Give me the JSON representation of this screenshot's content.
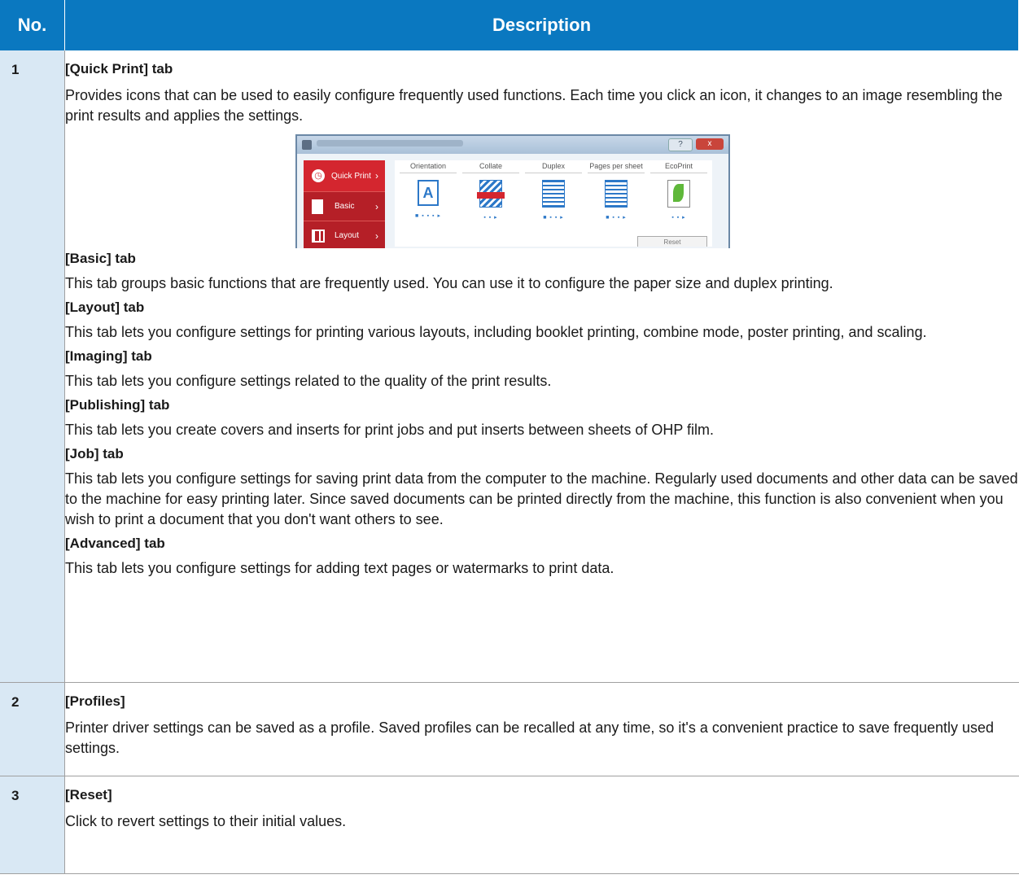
{
  "table": {
    "headers": {
      "no": "No.",
      "description": "Description"
    },
    "row1": {
      "no": "1",
      "sections": [
        {
          "heading": "[Quick Print] tab",
          "text": "Provides icons that can be used to easily configure frequently used functions. Each time you click an icon, it changes to an image resembling the print results and applies the settings."
        },
        {
          "heading": "[Basic] tab",
          "text": "This tab groups basic functions that are frequently used. You can use it to configure the paper size and duplex printing."
        },
        {
          "heading": "[Layout] tab",
          "text": "This tab lets you configure settings for printing various layouts, including booklet printing, combine mode, poster printing, and scaling."
        },
        {
          "heading": "[Imaging] tab",
          "text": "This tab lets you configure settings related to the quality of the print results."
        },
        {
          "heading": "[Publishing] tab",
          "text": "This tab lets you create covers and inserts for print jobs and put inserts between sheets of OHP film."
        },
        {
          "heading": "[Job] tab",
          "text": "This tab lets you configure settings for saving print data from the computer to the machine. Regularly used documents and other data can be saved to the machine for easy printing later. Since saved documents can be printed directly from the machine, this function is also convenient when you wish to print a document that you don't want others to see."
        },
        {
          "heading": "[Advanced] tab",
          "text": "This tab lets you configure settings for adding text pages or watermarks to print data."
        }
      ]
    },
    "row2": {
      "no": "2",
      "heading": "[Profiles]",
      "text": "Printer driver settings can be saved as a profile. Saved profiles can be recalled at any time, so it's a convenient practice to save frequently used settings."
    },
    "row3": {
      "no": "3",
      "heading": "[Reset]",
      "text": "Click to revert settings to their initial values."
    }
  },
  "screenshot": {
    "help": "?",
    "close": "x",
    "tabs": [
      "Quick Print",
      "Basic",
      "Layout"
    ],
    "columns": [
      "Orientation",
      "Collate",
      "Duplex",
      "Pages per sheet",
      "EcoPrint"
    ],
    "orientation_glyph": "A",
    "dots": [
      "■ ▪ ▪ ▪ ▸",
      "▪ ▪ ▸",
      "■ ▪ ▪ ▸",
      "■ ▪ ▪ ▸",
      "▪ ▪ ▸"
    ],
    "reset": "Reset"
  },
  "colors": {
    "header_bg": "#0a78c0",
    "no_col_bg": "#d9e8f4",
    "tab_red": "#d4262f"
  }
}
